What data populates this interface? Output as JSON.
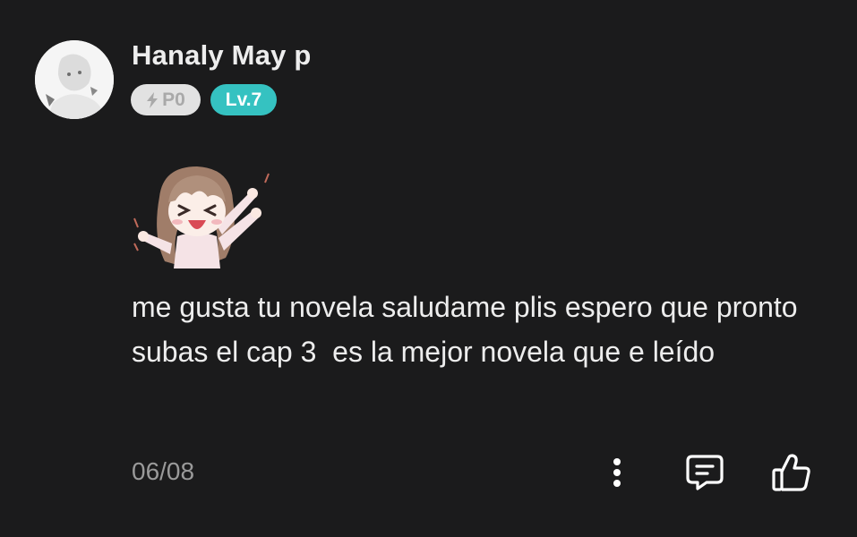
{
  "user": {
    "name": "Hanaly May p",
    "points_badge": "P0",
    "level_badge": "Lv.7"
  },
  "comment": {
    "text": "me gusta tu novela saludame plis espero que pronto subas el cap 3  es la mejor novela que e leído",
    "date": "06/08"
  },
  "icons": {
    "avatar": "user-avatar",
    "points": "lightning-icon",
    "sticker": "anime-girl-sticker",
    "more": "more-vertical-icon",
    "reply": "comment-icon",
    "like": "thumbs-up-icon"
  },
  "colors": {
    "background": "#1b1b1c",
    "level_badge": "#35c2c1",
    "points_badge": "#e2e2e2",
    "text": "#ededed",
    "muted": "#9a9a9a"
  }
}
